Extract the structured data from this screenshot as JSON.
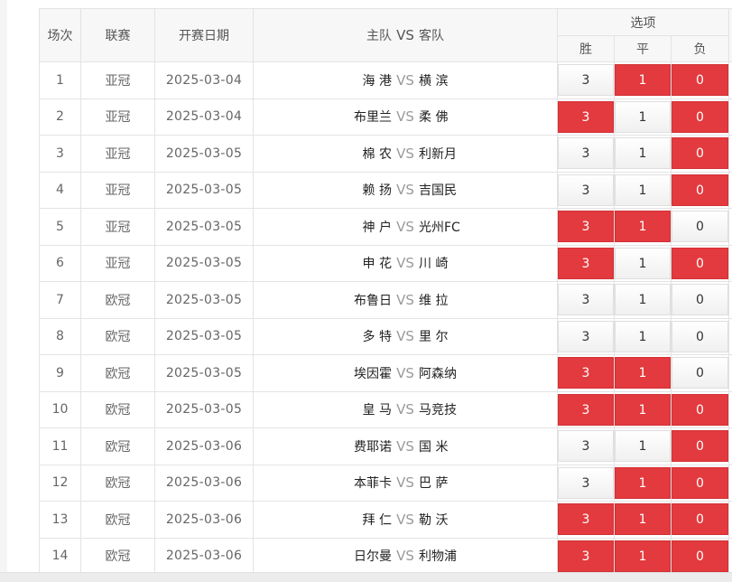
{
  "header": {
    "no": "场次",
    "league": "联赛",
    "date": "开赛日期",
    "home": "主队",
    "vs": "VS",
    "away": "客队",
    "options": "选项",
    "win": "胜",
    "draw": "平",
    "loss": "负"
  },
  "colors": {
    "selected": "#e23a3e",
    "unselected": "#f4f4f4"
  },
  "rows": [
    {
      "no": "1",
      "league": "亚冠",
      "date": "2025-03-04",
      "home": "海 港",
      "vs": "VS",
      "away": "横 滨",
      "win": "3",
      "draw": "1",
      "loss": "0",
      "win_sel": false,
      "draw_sel": true,
      "loss_sel": true
    },
    {
      "no": "2",
      "league": "亚冠",
      "date": "2025-03-04",
      "home": "布里兰",
      "vs": "VS",
      "away": "柔 佛",
      "win": "3",
      "draw": "1",
      "loss": "0",
      "win_sel": true,
      "draw_sel": false,
      "loss_sel": true
    },
    {
      "no": "3",
      "league": "亚冠",
      "date": "2025-03-05",
      "home": "棉 农",
      "vs": "VS",
      "away": "利新月",
      "win": "3",
      "draw": "1",
      "loss": "0",
      "win_sel": false,
      "draw_sel": false,
      "loss_sel": true
    },
    {
      "no": "4",
      "league": "亚冠",
      "date": "2025-03-05",
      "home": "赖 扬",
      "vs": "VS",
      "away": "吉国民",
      "win": "3",
      "draw": "1",
      "loss": "0",
      "win_sel": false,
      "draw_sel": false,
      "loss_sel": true
    },
    {
      "no": "5",
      "league": "亚冠",
      "date": "2025-03-05",
      "home": "神 户",
      "vs": "VS",
      "away": "光州FC",
      "win": "3",
      "draw": "1",
      "loss": "0",
      "win_sel": true,
      "draw_sel": true,
      "loss_sel": false
    },
    {
      "no": "6",
      "league": "亚冠",
      "date": "2025-03-05",
      "home": "申 花",
      "vs": "VS",
      "away": "川 崎",
      "win": "3",
      "draw": "1",
      "loss": "0",
      "win_sel": true,
      "draw_sel": false,
      "loss_sel": true
    },
    {
      "no": "7",
      "league": "欧冠",
      "date": "2025-03-05",
      "home": "布鲁日",
      "vs": "VS",
      "away": "维 拉",
      "win": "3",
      "draw": "1",
      "loss": "0",
      "win_sel": false,
      "draw_sel": false,
      "loss_sel": false
    },
    {
      "no": "8",
      "league": "欧冠",
      "date": "2025-03-05",
      "home": "多 特",
      "vs": "VS",
      "away": "里 尔",
      "win": "3",
      "draw": "1",
      "loss": "0",
      "win_sel": false,
      "draw_sel": false,
      "loss_sel": false
    },
    {
      "no": "9",
      "league": "欧冠",
      "date": "2025-03-05",
      "home": "埃因霍",
      "vs": "VS",
      "away": "阿森纳",
      "win": "3",
      "draw": "1",
      "loss": "0",
      "win_sel": true,
      "draw_sel": true,
      "loss_sel": false
    },
    {
      "no": "10",
      "league": "欧冠",
      "date": "2025-03-05",
      "home": "皇 马",
      "vs": "VS",
      "away": "马竞技",
      "win": "3",
      "draw": "1",
      "loss": "0",
      "win_sel": true,
      "draw_sel": true,
      "loss_sel": true
    },
    {
      "no": "11",
      "league": "欧冠",
      "date": "2025-03-06",
      "home": "费耶诺",
      "vs": "VS",
      "away": "国 米",
      "win": "3",
      "draw": "1",
      "loss": "0",
      "win_sel": false,
      "draw_sel": false,
      "loss_sel": true
    },
    {
      "no": "12",
      "league": "欧冠",
      "date": "2025-03-06",
      "home": "本菲卡",
      "vs": "VS",
      "away": "巴 萨",
      "win": "3",
      "draw": "1",
      "loss": "0",
      "win_sel": false,
      "draw_sel": true,
      "loss_sel": true
    },
    {
      "no": "13",
      "league": "欧冠",
      "date": "2025-03-06",
      "home": "拜 仁",
      "vs": "VS",
      "away": "勒 沃",
      "win": "3",
      "draw": "1",
      "loss": "0",
      "win_sel": true,
      "draw_sel": true,
      "loss_sel": true
    },
    {
      "no": "14",
      "league": "欧冠",
      "date": "2025-03-06",
      "home": "日尔曼",
      "vs": "VS",
      "away": "利物浦",
      "win": "3",
      "draw": "1",
      "loss": "0",
      "win_sel": true,
      "draw_sel": true,
      "loss_sel": true
    }
  ]
}
